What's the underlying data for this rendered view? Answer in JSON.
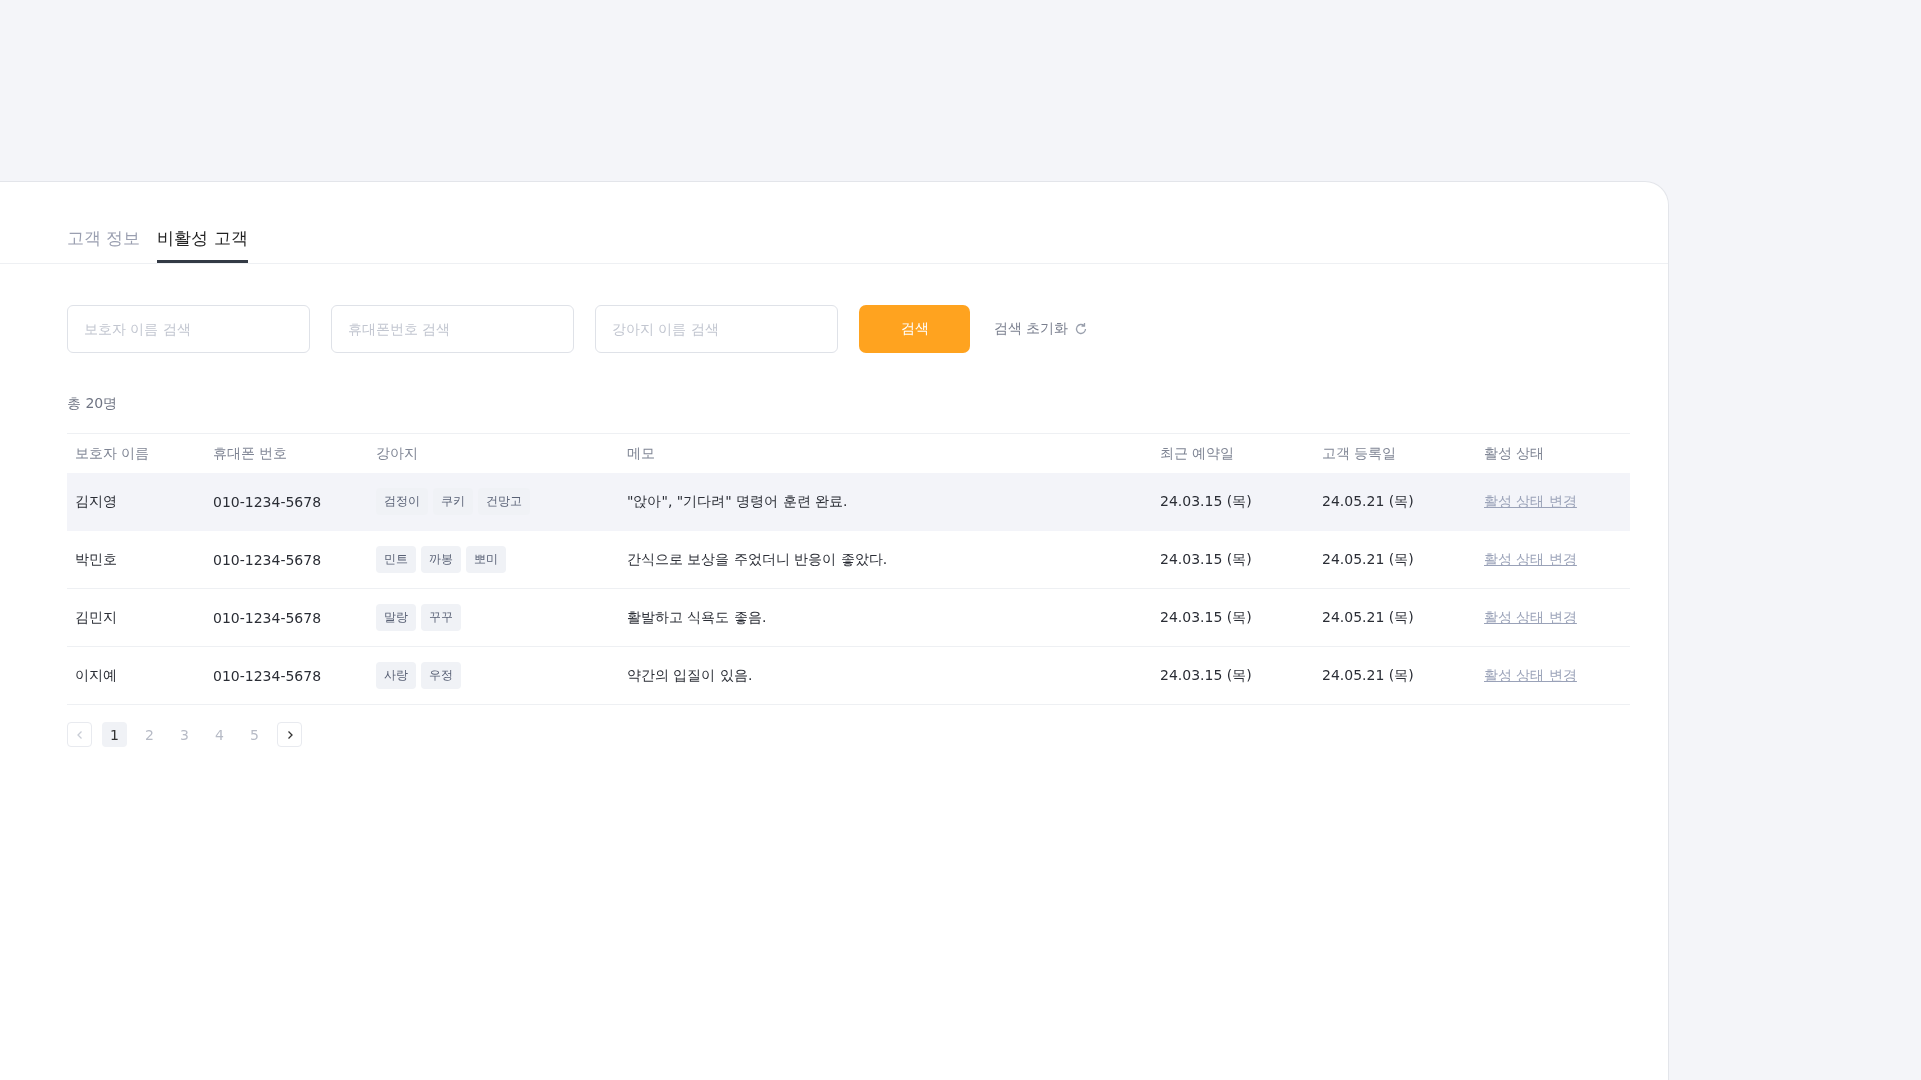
{
  "tabs": [
    {
      "label": "고객 정보",
      "selected": false
    },
    {
      "label": "비활성 고객",
      "selected": true
    }
  ],
  "search": {
    "fields": [
      {
        "placeholder": "보호자 이름 검색"
      },
      {
        "placeholder": "휴대폰번호 검색"
      },
      {
        "placeholder": "강아지 이름 검색"
      }
    ],
    "button": "검색",
    "reset": "검색 초기화"
  },
  "total": "총 20명",
  "table": {
    "columns": [
      "보호자 이름",
      "휴대폰 번호",
      "강아지",
      "메모",
      "최근 예약일",
      "고객 등록일",
      "활성 상태"
    ],
    "rows": [
      {
        "selected": true,
        "guardian": "김지영",
        "phone": "010-1234-5678",
        "dogs": [
          "검정이",
          "쿠키",
          "건망고"
        ],
        "memo": "\"앉아\", \"기다려\" 명령어 훈련 완료.",
        "recent": "24.03.15 (목)",
        "registered": "24.05.21 (목)",
        "action": "활성 상태 변경"
      },
      {
        "selected": false,
        "guardian": "박민호",
        "phone": "010-1234-5678",
        "dogs": [
          "민트",
          "까봉",
          "뽀미"
        ],
        "memo": "간식으로 보상을 주었더니 반응이 좋았다.",
        "recent": "24.03.15 (목)",
        "registered": "24.05.21 (목)",
        "action": "활성 상태 변경"
      },
      {
        "selected": false,
        "guardian": "김민지",
        "phone": "010-1234-5678",
        "dogs": [
          "말랑",
          "꾸꾸"
        ],
        "memo": "활발하고 식욕도 좋음.",
        "recent": "24.03.15 (목)",
        "registered": "24.05.21 (목)",
        "action": "활성 상태 변경"
      },
      {
        "selected": false,
        "guardian": "이지예",
        "phone": "010-1234-5678",
        "dogs": [
          "사랑",
          "우정"
        ],
        "memo": "약간의 입질이 있음.",
        "recent": "24.03.15 (목)",
        "registered": "24.05.21 (목)",
        "action": "활성 상태 변경"
      }
    ]
  },
  "pagination": {
    "prev_disabled": true,
    "next_disabled": false,
    "pages": [
      {
        "label": "1",
        "selected": true
      },
      {
        "label": "2",
        "selected": false
      },
      {
        "label": "3",
        "selected": false
      },
      {
        "label": "4",
        "selected": false
      },
      {
        "label": "5",
        "selected": false
      }
    ]
  }
}
